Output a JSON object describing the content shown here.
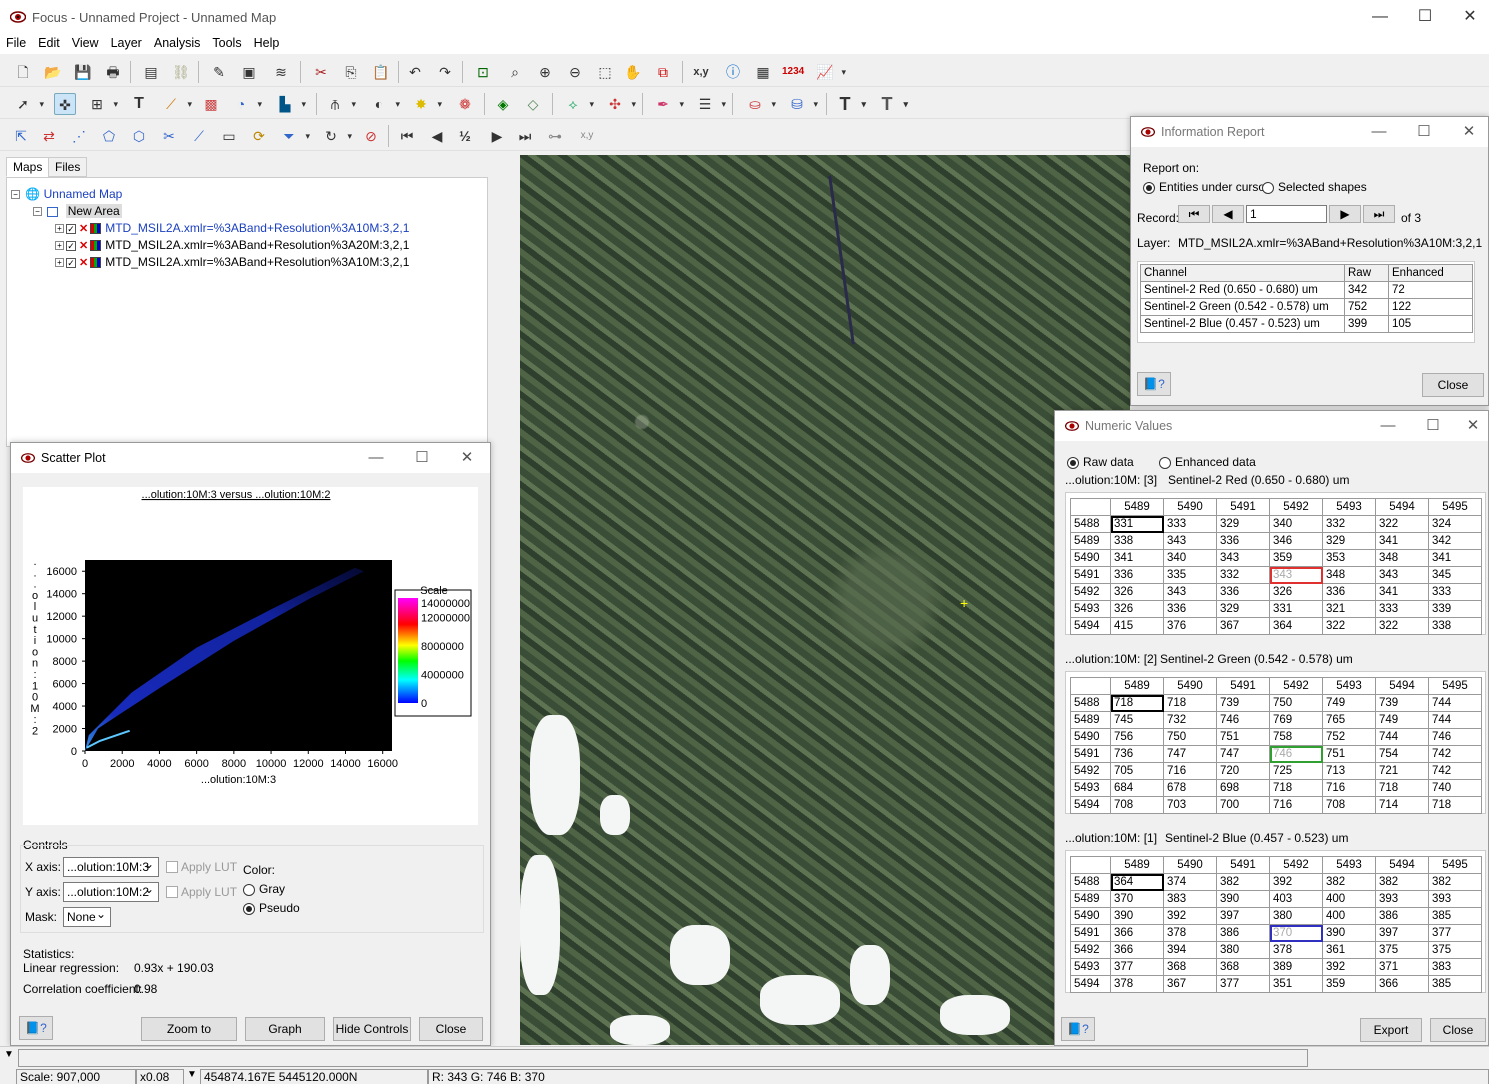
{
  "app": {
    "title": "Focus - Unnamed Project - Unnamed Map",
    "minimize": "—",
    "maximize": "☐",
    "close": "✕"
  },
  "menu": [
    "File",
    "Edit",
    "View",
    "Layer",
    "Analysis",
    "Tools",
    "Help"
  ],
  "tabs": {
    "maps": "Maps",
    "files": "Files"
  },
  "tree": {
    "map_name": "Unnamed Map",
    "area_name": "New Area",
    "layers": [
      "MTD_MSIL2A.xmlr=%3ABand+Resolution%3A10M:3,2,1",
      "MTD_MSIL2A.xmlr=%3ABand+Resolution%3A20M:3,2,1",
      "MTD_MSIL2A.xmlr=%3ABand+Resolution%3A10M:3,2,1"
    ]
  },
  "info_report": {
    "title": "Information Report",
    "report_on": "Report on:",
    "opt_entities": "Entities under cursor",
    "opt_shapes": "Selected shapes",
    "record_label": "Record:",
    "record_value": "1",
    "record_of": "of 3",
    "layer_label": "Layer:",
    "layer_value": "MTD_MSIL2A.xmlr=%3ABand+Resolution%3A10M:3,2,1",
    "headers": [
      "Channel",
      "Raw",
      "Enhanced"
    ],
    "rows": [
      [
        "Sentinel-2 Red (0.650 - 0.680) um",
        "342",
        "72"
      ],
      [
        "Sentinel-2 Green (0.542 - 0.578) um",
        "752",
        "122"
      ],
      [
        "Sentinel-2 Blue (0.457 - 0.523) um",
        "399",
        "105"
      ]
    ],
    "close": "Close"
  },
  "numeric": {
    "title": "Numeric Values",
    "opt_raw": "Raw data",
    "opt_enh": "Enhanced data",
    "cols": [
      "5489",
      "5490",
      "5491",
      "5492",
      "5493",
      "5494",
      "5495"
    ],
    "rows": [
      "5488",
      "5489",
      "5490",
      "5491",
      "5492",
      "5493",
      "5494"
    ],
    "blocks": [
      {
        "label": "...olution:10M: [3]",
        "channel": "Sentinel-2 Red (0.650 - 0.680) um",
        "values": [
          [
            "331",
            "333",
            "329",
            "340",
            "332",
            "322",
            "324"
          ],
          [
            "338",
            "343",
            "336",
            "346",
            "329",
            "341",
            "342"
          ],
          [
            "341",
            "340",
            "343",
            "359",
            "353",
            "348",
            "341"
          ],
          [
            "336",
            "335",
            "332",
            "343",
            "348",
            "343",
            "345"
          ],
          [
            "326",
            "343",
            "336",
            "326",
            "336",
            "341",
            "333"
          ],
          [
            "326",
            "336",
            "329",
            "331",
            "321",
            "333",
            "339"
          ],
          [
            "415",
            "376",
            "367",
            "364",
            "322",
            "322",
            "338"
          ]
        ],
        "highlight_color": "#e03030"
      },
      {
        "label": "...olution:10M: [2]",
        "channel": "Sentinel-2 Green (0.542 - 0.578) um",
        "values": [
          [
            "718",
            "718",
            "739",
            "750",
            "749",
            "739",
            "744"
          ],
          [
            "745",
            "732",
            "746",
            "769",
            "765",
            "749",
            "744"
          ],
          [
            "756",
            "750",
            "751",
            "758",
            "752",
            "744",
            "746"
          ],
          [
            "736",
            "747",
            "747",
            "746",
            "751",
            "754",
            "742"
          ],
          [
            "705",
            "716",
            "720",
            "725",
            "713",
            "721",
            "742"
          ],
          [
            "684",
            "678",
            "698",
            "718",
            "716",
            "718",
            "740"
          ],
          [
            "708",
            "703",
            "700",
            "716",
            "708",
            "714",
            "718"
          ]
        ],
        "highlight_color": "#30a030"
      },
      {
        "label": "...olution:10M: [1]",
        "channel": "Sentinel-2 Blue (0.457 - 0.523) um",
        "values": [
          [
            "364",
            "374",
            "382",
            "392",
            "382",
            "382",
            "382"
          ],
          [
            "370",
            "383",
            "390",
            "403",
            "400",
            "393",
            "393"
          ],
          [
            "390",
            "392",
            "397",
            "380",
            "400",
            "386",
            "385"
          ],
          [
            "366",
            "378",
            "386",
            "370",
            "390",
            "397",
            "377"
          ],
          [
            "366",
            "394",
            "380",
            "378",
            "361",
            "375",
            "375"
          ],
          [
            "377",
            "368",
            "368",
            "389",
            "392",
            "371",
            "383"
          ],
          [
            "378",
            "367",
            "377",
            "351",
            "359",
            "366",
            "385"
          ]
        ],
        "highlight_color": "#3030c0"
      }
    ],
    "export": "Export",
    "close": "Close"
  },
  "scatter": {
    "title": "Scatter Plot",
    "plot_title": "...olution:10M:3 versus ...olution:10M:2",
    "scale_label": "Scale",
    "controls_label": "Controls",
    "xaxis_label": "X axis:",
    "xaxis_value": "...olution:10M:3",
    "yaxis_label": "Y axis:",
    "yaxis_value": "...olution:10M:2",
    "mask_label": "Mask:",
    "mask_value": "None",
    "apply_lut": "Apply LUT",
    "color_label": "Color:",
    "opt_gray": "Gray",
    "opt_pseudo": "Pseudo",
    "stats_label": "Statistics:",
    "linreg_label": "Linear regression:",
    "linreg_value": "0.93x + 190.03",
    "corr_label": "Correlation coefficient:",
    "corr_value": "0.98",
    "btn_zoom": "Zoom to Overview",
    "btn_graph": "Graph Controls",
    "btn_hide": "Hide Controls",
    "btn_close": "Close"
  },
  "chart_data": {
    "type": "heatmap",
    "title": "...olution:10M:3 versus ...olution:10M:2",
    "xlabel": "...olution:10M:3",
    "ylabel": "...olution:10M:2",
    "xlim": [
      0,
      16500
    ],
    "ylim": [
      0,
      17000
    ],
    "x_ticks": [
      0,
      2000,
      4000,
      6000,
      8000,
      10000,
      12000,
      14000,
      16000
    ],
    "y_ticks": [
      0,
      2000,
      4000,
      6000,
      8000,
      10000,
      12000,
      14000,
      16000
    ],
    "scale_ticks": [
      14000000,
      12000000,
      8000000,
      4000000,
      0
    ],
    "scale_title": "Scale",
    "colormap": "pseudo",
    "background": "#000000"
  },
  "status": {
    "scale": "Scale: 907,000",
    "zoom": "x0.08",
    "coords": "454874.167E 5445120.000N",
    "rgb": "R:  343 G:  746 B:  370"
  }
}
